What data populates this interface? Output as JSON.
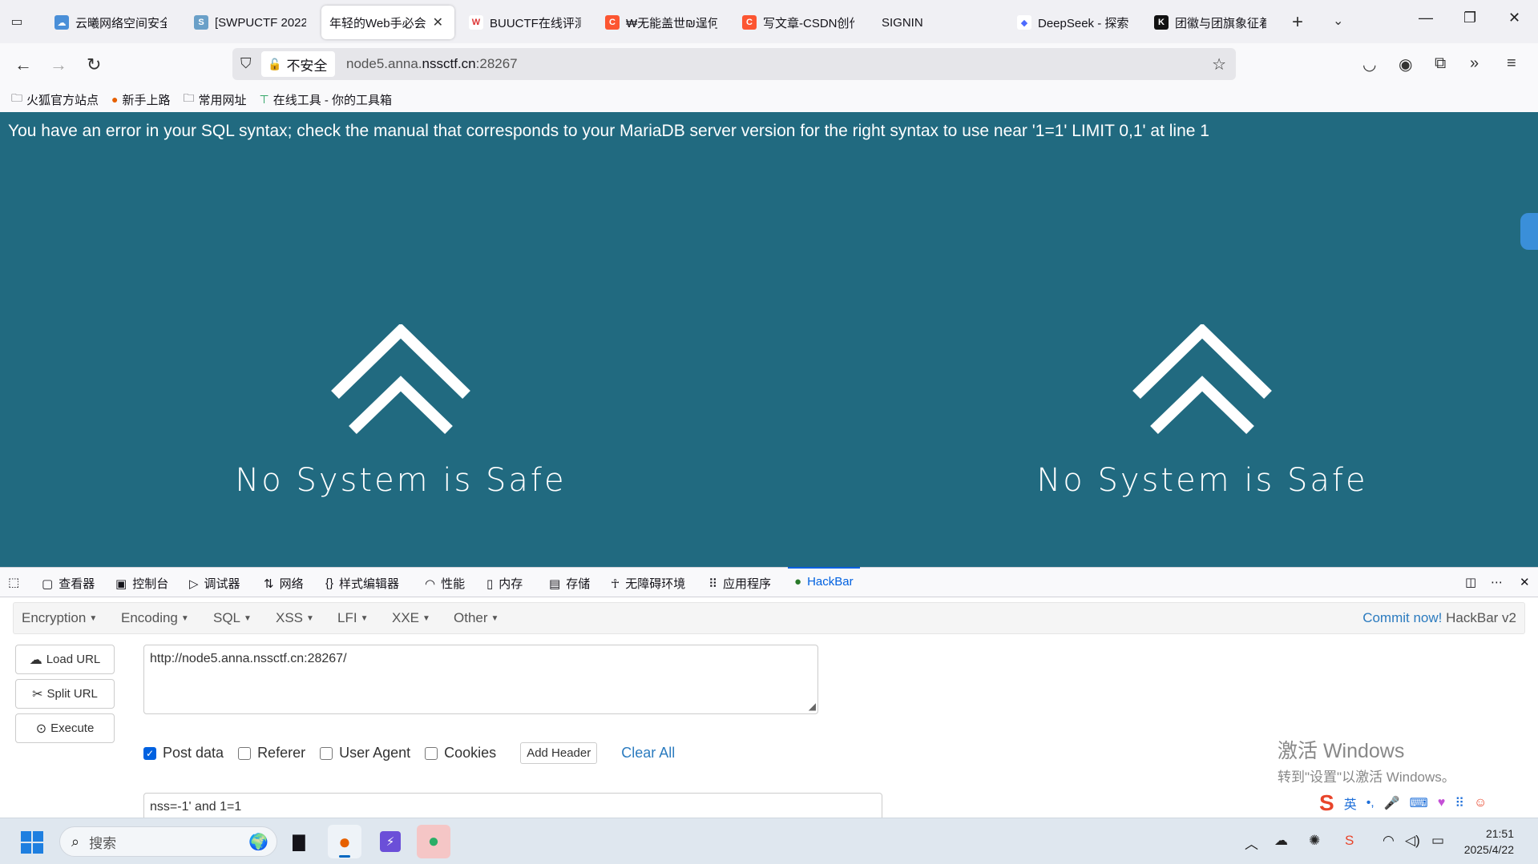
{
  "tabs": [
    {
      "label": "云曦网络空间安全",
      "icon": "cloud-icon",
      "color": "#4a8fd8",
      "active": false
    },
    {
      "label": "[SWPUCTF 2022",
      "icon": "swpu-icon",
      "color": "#6aa0c8",
      "active": false
    },
    {
      "label": "年轻的Web手必会",
      "icon": "",
      "color": "",
      "active": true
    },
    {
      "label": "BUUCTF在线评测",
      "icon": "buu-icon",
      "color": "#d33",
      "active": false
    },
    {
      "label": "₩无能盖世₪逞何",
      "icon": "csdn-icon",
      "color": "#fc5531",
      "active": false
    },
    {
      "label": "写文章-CSDN创作",
      "icon": "csdn-icon",
      "color": "#fc5531",
      "active": false
    },
    {
      "label": "SIGNIN",
      "icon": "",
      "color": "",
      "active": false
    },
    {
      "label": "DeepSeek - 探索",
      "icon": "deepseek-icon",
      "color": "#4d6bfe",
      "active": false
    },
    {
      "label": "团徽与团旗象征着",
      "icon": "k-icon",
      "color": "#111",
      "active": false
    }
  ],
  "nav": {
    "insecure_label": "不安全",
    "url_host_prefix": "node5.anna.",
    "url_host_main": "nssctf.cn",
    "url_port": ":28267"
  },
  "bookmarks": [
    {
      "label": "火狐官方站点",
      "icon": "folder-icon"
    },
    {
      "label": "新手上路",
      "icon": "firefox-icon"
    },
    {
      "label": "常用网址",
      "icon": "folder-icon"
    },
    {
      "label": "在线工具 - 你的工具箱",
      "icon": "tools-icon"
    }
  ],
  "page": {
    "error_text": "You have an error in your SQL syntax; check the manual that corresponds to your MariaDB server version for the right syntax to use near '1=1' LIMIT 0,1' at line 1",
    "slogan": "No System is Safe",
    "background": "#216a80"
  },
  "devtools": {
    "tabs": [
      {
        "label": "查看器",
        "icon": "inspector-icon"
      },
      {
        "label": "控制台",
        "icon": "console-icon"
      },
      {
        "label": "调试器",
        "icon": "debugger-icon"
      },
      {
        "label": "网络",
        "icon": "network-icon"
      },
      {
        "label": "样式编辑器",
        "icon": "style-editor-icon"
      },
      {
        "label": "性能",
        "icon": "performance-icon"
      },
      {
        "label": "内存",
        "icon": "memory-icon"
      },
      {
        "label": "存储",
        "icon": "storage-icon"
      },
      {
        "label": "无障碍环境",
        "icon": "accessibility-icon"
      },
      {
        "label": "应用程序",
        "icon": "application-icon"
      },
      {
        "label": "HackBar",
        "icon": "hackbar-icon"
      }
    ],
    "active_tab": "HackBar"
  },
  "hackbar": {
    "menu": [
      "Encryption",
      "Encoding",
      "SQL",
      "XSS",
      "LFI",
      "XXE",
      "Other"
    ],
    "commit_link": "Commit now!",
    "version": "HackBar v2",
    "buttons": {
      "load": "Load URL",
      "split": "Split URL",
      "execute": "Execute"
    },
    "url_value": "http://node5.anna.nssctf.cn:28267/",
    "options": {
      "post_data": "Post data",
      "referer": "Referer",
      "user_agent": "User Agent",
      "cookies": "Cookies",
      "add_header": "Add Header",
      "clear_all": "Clear All"
    },
    "post_checked": true,
    "post_value": "nss=-1' and 1=1"
  },
  "watermark": {
    "line1": "激活 Windows",
    "line2": "转到\"设置\"以激活 Windows。"
  },
  "ime": {
    "lang": "英"
  },
  "taskbar": {
    "search_placeholder": "搜索",
    "time": "21:51",
    "date": "2025/4/22"
  }
}
